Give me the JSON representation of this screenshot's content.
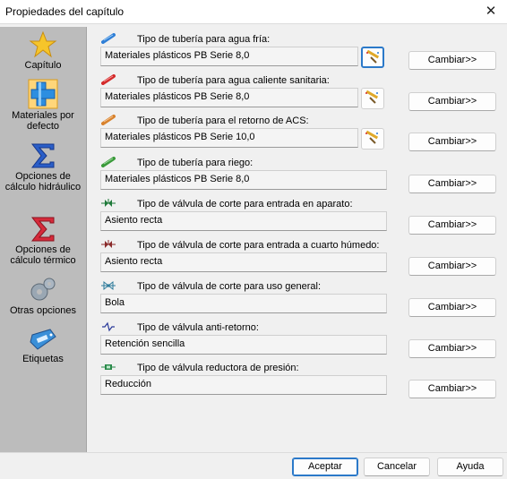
{
  "window": {
    "title": "Propiedades del capítulo",
    "close_glyph": "✕"
  },
  "sidebar": {
    "items": [
      {
        "label": "Capítulo",
        "icon": "star-icon"
      },
      {
        "label": "Materiales por defecto",
        "icon": "pipe-fitting-icon",
        "selected": true
      },
      {
        "label": "Opciones de cálculo hidráulico",
        "icon": "sigma-blue-icon"
      },
      {
        "label": "Opciones de cálculo térmico",
        "icon": "sigma-red-icon"
      },
      {
        "label": "Otras opciones",
        "icon": "gears-icon"
      },
      {
        "label": "Etiquetas",
        "icon": "tag-icon"
      }
    ]
  },
  "sections": [
    {
      "label": "Tipo de tubería para agua fría:",
      "value": "Materiales plásticos PB Serie 8,0",
      "icon": "blue-pipe-icon",
      "icon_color": "#2f7fd6",
      "has_picker": true,
      "picker_active": true
    },
    {
      "label": "Tipo de tubería para agua caliente sanitaria:",
      "value": "Materiales plásticos PB Serie 8,0",
      "icon": "red-pipe-icon",
      "icon_color": "#d42a2a",
      "has_picker": true
    },
    {
      "label": "Tipo de tubería para el retorno de ACS:",
      "value": "Materiales plásticos PB Serie 10,0",
      "icon": "orange-pipe-icon",
      "icon_color": "#d8822c",
      "has_picker": true
    },
    {
      "label": "Tipo de tubería para riego:",
      "value": "Materiales plásticos PB Serie 8,0",
      "icon": "green-pipe-icon",
      "icon_color": "#3a9a3a",
      "has_picker": false
    },
    {
      "label": "Tipo de válvula de corte para entrada en aparato:",
      "value": "Asiento recta",
      "icon": "shutoff-valve-icon",
      "icon_color": "#1f7a3a",
      "has_picker": false
    },
    {
      "label": "Tipo de válvula de corte para entrada a cuarto húmedo:",
      "value": "Asiento recta",
      "icon": "wet-room-valve-icon",
      "icon_color": "#8a2a2a",
      "has_picker": false
    },
    {
      "label": "Tipo de válvula de corte para uso general:",
      "value": "Bola",
      "icon": "ball-valve-icon",
      "icon_color": "#2c7a9a",
      "has_picker": false
    },
    {
      "label": "Tipo de válvula anti-retorno:",
      "value": "Retención sencilla",
      "icon": "check-valve-icon",
      "icon_color": "#2a3a9a",
      "has_picker": false
    },
    {
      "label": "Tipo de válvula reductora de presión:",
      "value": "Reducción",
      "icon": "pressure-reducer-icon",
      "icon_color": "#2a8a4a",
      "has_picker": false
    }
  ],
  "change_label": "Cambiar>>",
  "footer": {
    "accept": "Aceptar",
    "cancel": "Cancelar",
    "help": "Ayuda"
  }
}
